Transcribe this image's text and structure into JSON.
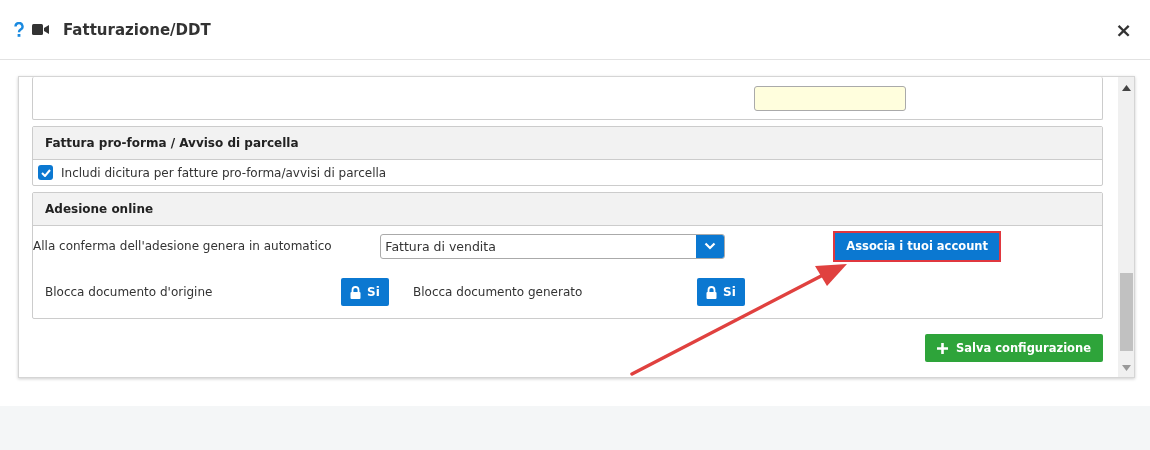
{
  "window": {
    "title": "Fatturazione/DDT",
    "close": "×"
  },
  "proforma": {
    "title": "Fattura pro-forma / Avviso di parcella",
    "checkbox": {
      "label": "Includi dicitura per fatture pro-forma/avvisi di parcella",
      "checked": true
    }
  },
  "adesione": {
    "title": "Adesione online",
    "generate": {
      "label": "Alla conferma dell'adesione genera in automatico",
      "value": "Fattura di vendita"
    },
    "associate_button": {
      "label": "Associa i tuoi account",
      "highlighted": true
    },
    "locks": [
      {
        "label": "Blocca documento d'origine",
        "button": "Si"
      },
      {
        "label": "Blocca documento generato",
        "button": "Si"
      }
    ]
  },
  "save_button": "Salva configurazione"
}
